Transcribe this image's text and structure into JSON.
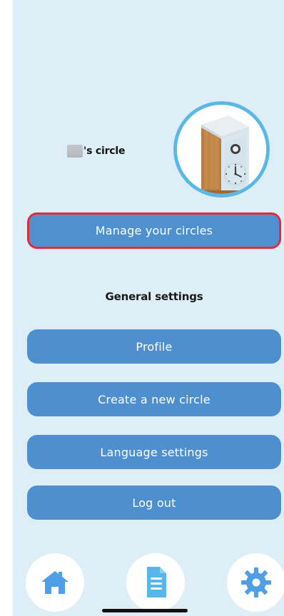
{
  "header": {
    "circle_name_suffix": "'s circle"
  },
  "actions": {
    "manage_circles_label": "Manage your circles"
  },
  "general": {
    "title": "General settings",
    "items": [
      {
        "label": "Profile"
      },
      {
        "label": "Create a new circle"
      },
      {
        "label": "Language settings"
      },
      {
        "label": "Log out"
      }
    ]
  },
  "nav": {
    "home_icon": "home-icon",
    "document_icon": "document-icon",
    "settings_icon": "gear-icon"
  },
  "colors": {
    "background": "#ddeef7",
    "button": "#4e90cf",
    "highlight_border": "#e22a3e",
    "avatar_ring": "#59b8e6",
    "nav_icon": "#4f9fe6"
  }
}
